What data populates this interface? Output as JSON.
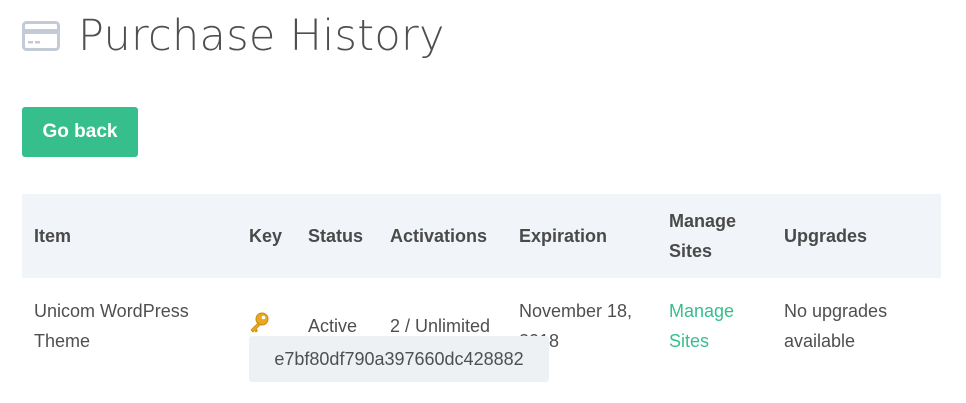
{
  "header": {
    "title": "Purchase History",
    "icon": "credit-card-icon"
  },
  "actions": {
    "go_back_label": "Go back"
  },
  "table": {
    "columns": [
      "Item",
      "Key",
      "Status",
      "Activations",
      "Expiration",
      "Manage Sites",
      "Upgrades"
    ],
    "rows": [
      {
        "item": "Unicom WordPress Theme",
        "key_icon": "key-icon",
        "status": "Active",
        "activations": "2 / Unlimited",
        "expiration": "November 18, 2018",
        "manage_sites": "Manage Sites",
        "upgrades": "No upgrades available"
      }
    ]
  },
  "tooltip": {
    "license_key": "e7bf80df790a397660dc428882"
  },
  "colors": {
    "accent": "#36bf8d",
    "header_bg": "#f1f4f8",
    "key_icon": "#e0a21b"
  }
}
